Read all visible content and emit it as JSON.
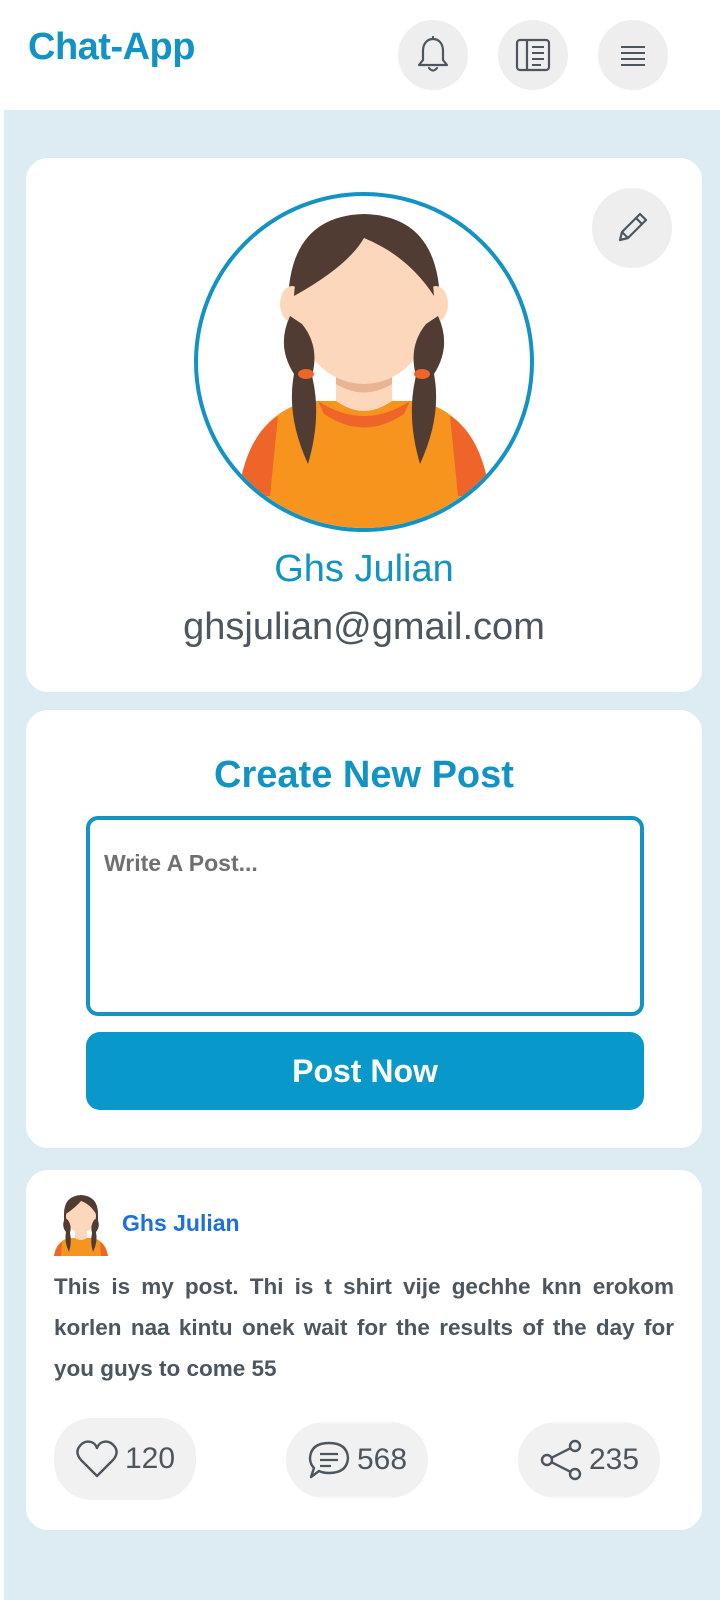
{
  "app": {
    "title": "Chat-App"
  },
  "header": {
    "buttons": [
      "bell-icon",
      "book-icon",
      "menu-icon"
    ]
  },
  "profile": {
    "name": "Ghs Julian",
    "email": "ghsjulian@gmail.com",
    "edit_icon": "pencil-icon"
  },
  "create_post": {
    "title": "Create New Post",
    "placeholder": "Write A Post...",
    "value": "",
    "submit_label": "Post Now"
  },
  "feed": {
    "posts": [
      {
        "author": "Ghs Julian",
        "text": "This is my post. Thi is t shirt vije gechhe knn erokom korlen naa kintu onek wait for the results of the day for you guys to come 55",
        "likes": "120",
        "comments": "568",
        "shares": "235"
      }
    ]
  },
  "colors": {
    "accent": "#1293c4",
    "button": "#0898c9",
    "author": "#1d6fe0",
    "background": "#ddecf3",
    "text": "#4c565e"
  }
}
